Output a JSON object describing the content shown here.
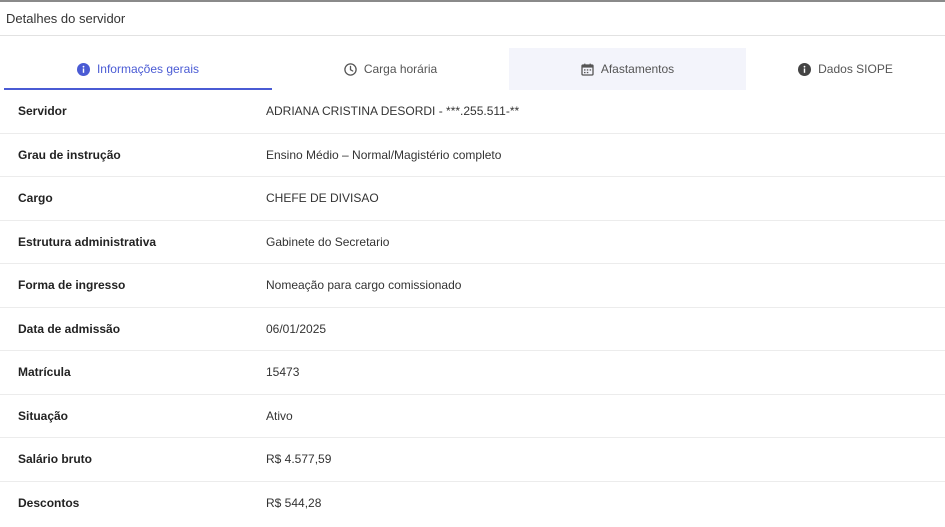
{
  "header": {
    "title": "Detalhes do servidor"
  },
  "tabs": [
    {
      "label": "Informações gerais",
      "icon": "info-icon"
    },
    {
      "label": "Carga horária",
      "icon": "clock-icon"
    },
    {
      "label": "Afastamentos",
      "icon": "calendar-icon"
    },
    {
      "label": "Dados SIOPE",
      "icon": "info-icon"
    }
  ],
  "colors": {
    "accent": "#4a5bd4",
    "hover_tab": "#f3f4fb"
  },
  "rows": [
    {
      "label": "Servidor",
      "value": "ADRIANA CRISTINA DESORDI - ***.255.511-**"
    },
    {
      "label": "Grau de instrução",
      "value": "Ensino Médio – Normal/Magistério completo"
    },
    {
      "label": "Cargo",
      "value": "CHEFE DE DIVISAO"
    },
    {
      "label": "Estrutura administrativa",
      "value": "Gabinete do Secretario"
    },
    {
      "label": "Forma de ingresso",
      "value": "Nomeação para cargo comissionado"
    },
    {
      "label": "Data de admissão",
      "value": "06/01/2025"
    },
    {
      "label": "Matrícula",
      "value": "15473"
    },
    {
      "label": "Situação",
      "value": "Ativo"
    },
    {
      "label": "Salário bruto",
      "value": "R$ 4.577,59"
    },
    {
      "label": "Descontos",
      "value": "R$ 544,28"
    }
  ]
}
